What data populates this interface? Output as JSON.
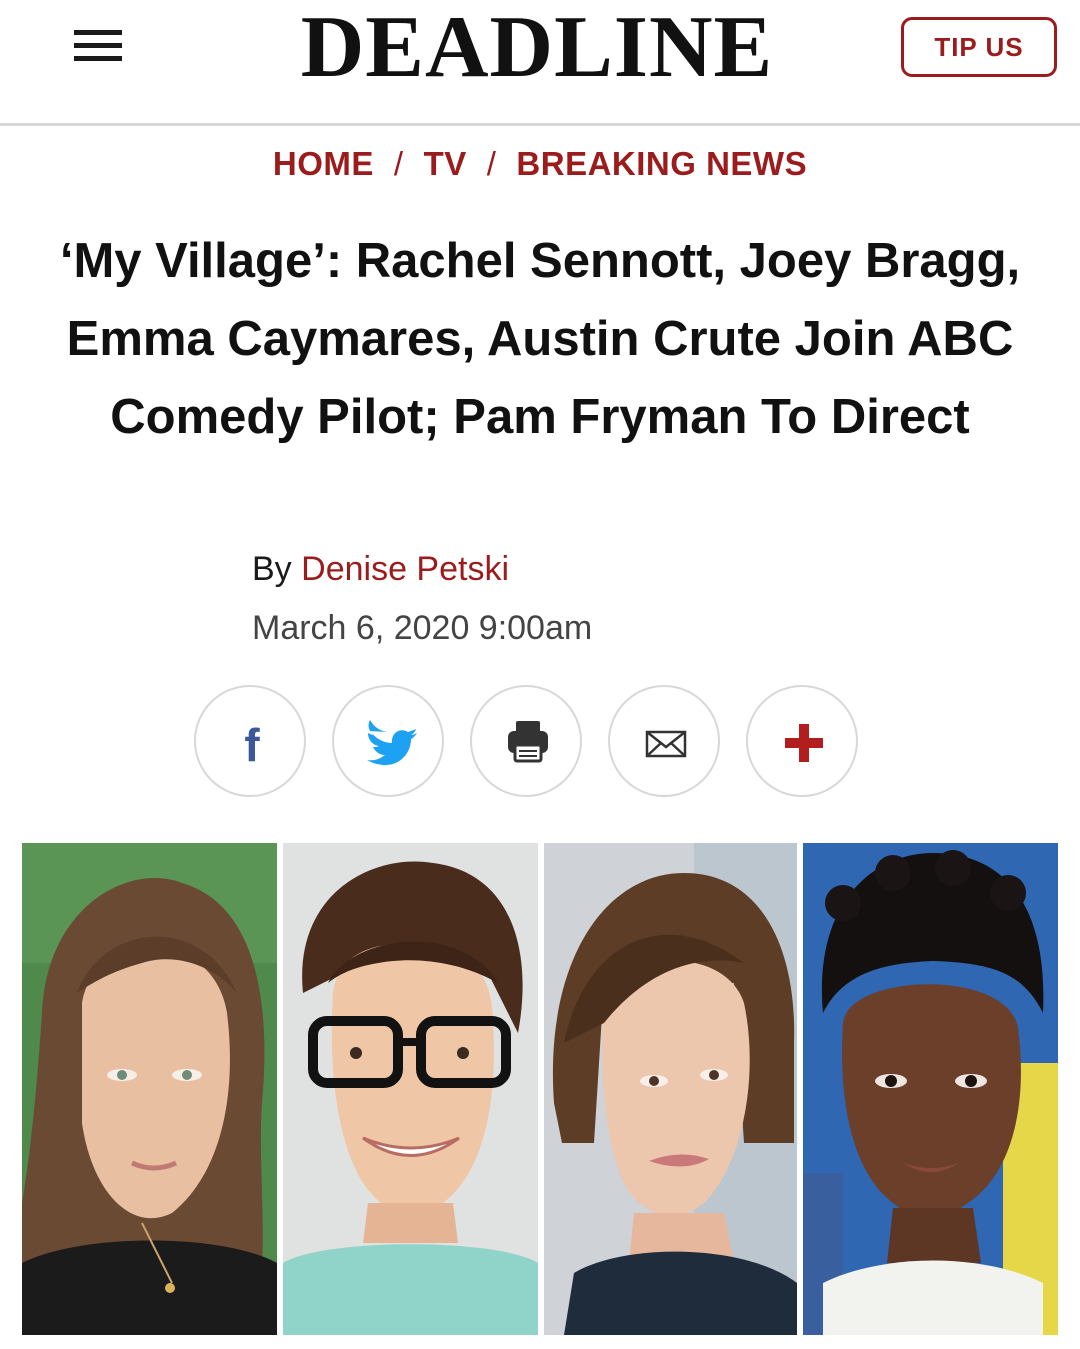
{
  "header": {
    "menu_icon": "hamburger-menu-icon",
    "logo": "DEADLINE",
    "tip_label": "TIP US"
  },
  "breadcrumb": {
    "items": [
      "HOME",
      "TV",
      "BREAKING NEWS"
    ],
    "separator": "/"
  },
  "article": {
    "headline": "‘My Village’: Rachel Sennott, Joey Bragg, Emma Caymares, Austin Crute Join ABC Comedy Pilot; Pam Fryman To Direct",
    "byline_prefix": "By",
    "author": "Denise Petski",
    "date": "March 6, 2020 9:00am"
  },
  "share": {
    "buttons": [
      {
        "icon": "facebook-icon",
        "color": "#3b5998"
      },
      {
        "icon": "twitter-icon",
        "color": "#1da1f2"
      },
      {
        "icon": "print-icon",
        "color": "#333333"
      },
      {
        "icon": "email-icon",
        "color": "#333333"
      },
      {
        "icon": "plus-icon",
        "color": "#b01e1e"
      }
    ]
  },
  "colors": {
    "accent": "#9b1c1c",
    "text": "#111111",
    "border": "#d6d6d6"
  },
  "image": {
    "panels": 4
  }
}
